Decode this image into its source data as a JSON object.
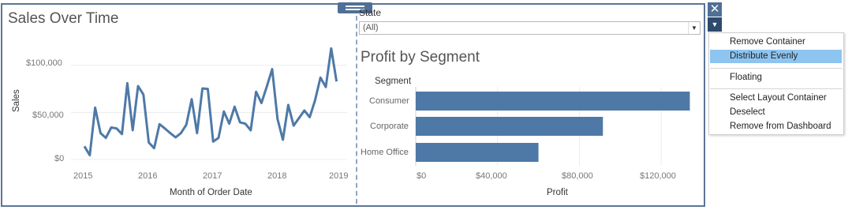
{
  "line_chart": {
    "title": "Sales Over Time",
    "ylabel": "Sales",
    "xlabel": "Month of Order Date",
    "y_ticks": [
      "$100,000",
      "$50,000",
      "$0"
    ],
    "x_ticks": [
      "2015",
      "2016",
      "2017",
      "2018",
      "2019"
    ]
  },
  "filter": {
    "label": "State",
    "value": "(All)"
  },
  "bar_chart": {
    "title": "Profit by Segment",
    "row_header": "Segment",
    "categories": [
      "Consumer",
      "Corporate",
      "Home Office"
    ],
    "xlabel": "Profit",
    "x_ticks": [
      "$0",
      "$40,000",
      "$80,000",
      "$120,000"
    ]
  },
  "controls": {
    "close_glyph": "✕",
    "menu_glyph": "▼"
  },
  "context_menu": {
    "items": [
      {
        "label": "Remove Container"
      },
      {
        "label": "Distribute Evenly"
      },
      {
        "label": "Floating"
      },
      {
        "label": "Select Layout Container"
      },
      {
        "label": "Deselect"
      },
      {
        "label": "Remove from Dashboard"
      }
    ]
  },
  "colors": {
    "mark": "#4e79a7",
    "border": "#5b7596",
    "highlight": "#8ec4f0",
    "annotation": "#f5e62c"
  },
  "chart_data": [
    {
      "type": "line",
      "title": "Sales Over Time",
      "xlabel": "Month of Order Date",
      "ylabel": "Sales",
      "x": [
        "2015-01",
        "2015-02",
        "2015-03",
        "2015-04",
        "2015-05",
        "2015-06",
        "2015-07",
        "2015-08",
        "2015-09",
        "2015-10",
        "2015-11",
        "2015-12",
        "2016-01",
        "2016-02",
        "2016-03",
        "2016-04",
        "2016-05",
        "2016-06",
        "2016-07",
        "2016-08",
        "2016-09",
        "2016-10",
        "2016-11",
        "2016-12",
        "2017-01",
        "2017-02",
        "2017-03",
        "2017-04",
        "2017-05",
        "2017-06",
        "2017-07",
        "2017-08",
        "2017-09",
        "2017-10",
        "2017-11",
        "2017-12",
        "2018-01",
        "2018-02",
        "2018-03",
        "2018-04",
        "2018-05",
        "2018-06",
        "2018-07",
        "2018-08",
        "2018-09",
        "2018-10",
        "2018-11",
        "2018-12"
      ],
      "values": [
        14000,
        4500,
        55000,
        28000,
        23000,
        34000,
        33000,
        27000,
        81000,
        31000,
        78000,
        69000,
        18000,
        12000,
        37500,
        33000,
        28000,
        23500,
        28000,
        37000,
        64000,
        28000,
        75500,
        75000,
        19000,
        23000,
        51000,
        38000,
        56000,
        39500,
        38000,
        31000,
        72000,
        60000,
        77500,
        96000,
        43000,
        21000,
        58000,
        36000,
        44000,
        52000,
        45000,
        63000,
        87000,
        77000,
        118000,
        83000
      ],
      "ylim": [
        0,
        125000
      ],
      "y_ticks": [
        0,
        50000,
        100000
      ],
      "x_tick_labels": [
        "2015",
        "2016",
        "2017",
        "2018",
        "2019"
      ],
      "grid": "horizontal"
    },
    {
      "type": "bar",
      "orientation": "horizontal",
      "title": "Profit by Segment",
      "xlabel": "Profit",
      "categories": [
        "Consumer",
        "Corporate",
        "Home Office"
      ],
      "values": [
        134000,
        91500,
        60000
      ],
      "xlim": [
        0,
        140000
      ],
      "x_ticks": [
        0,
        40000,
        80000,
        120000
      ],
      "grid": "vertical"
    }
  ]
}
